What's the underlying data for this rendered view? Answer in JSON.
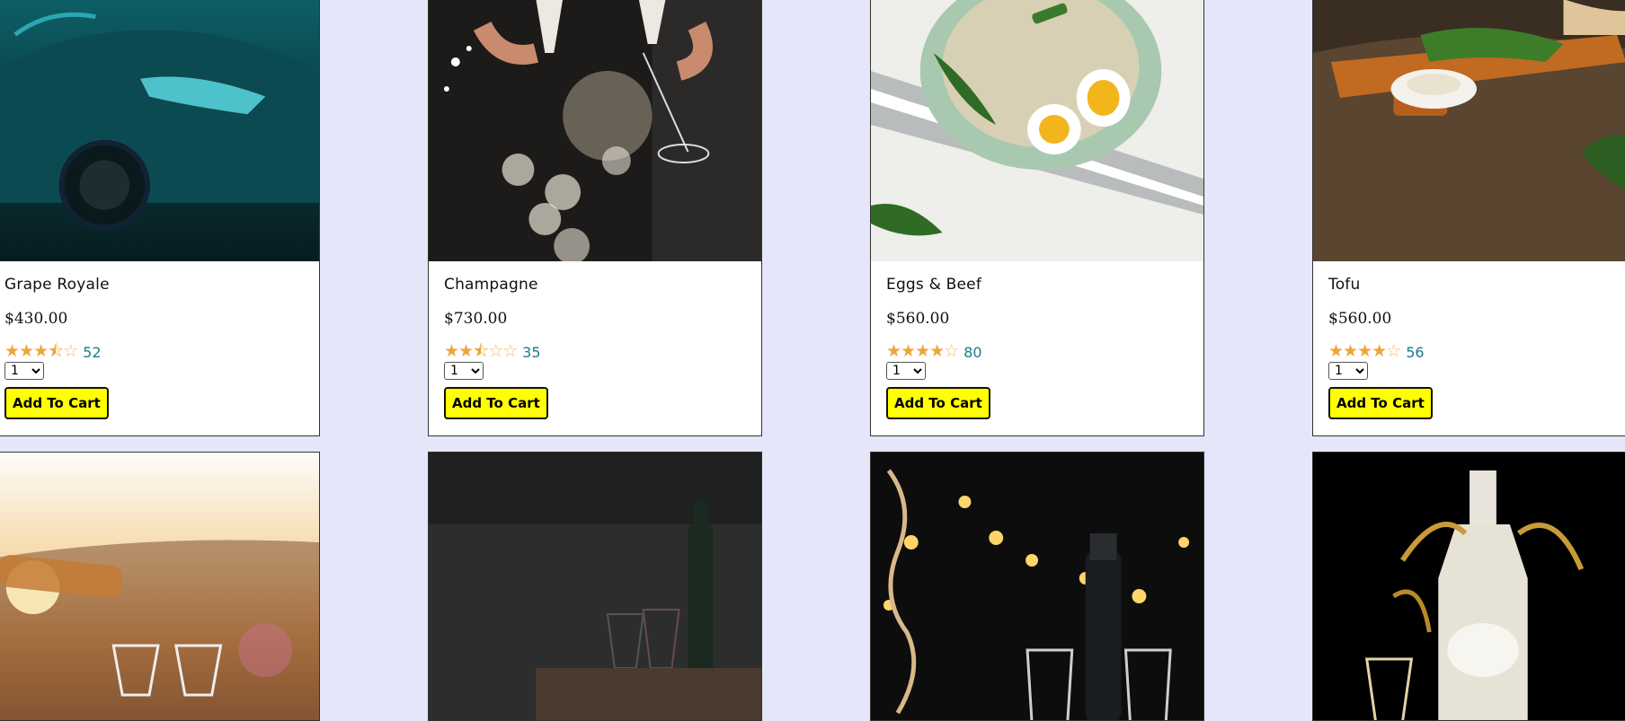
{
  "products": [
    {
      "name": "Grape Royale",
      "price": "$430.00",
      "rating": 3.5,
      "reviews": "52",
      "qty": "1",
      "button": "Add To Cart"
    },
    {
      "name": "Champagne",
      "price": "$730.00",
      "rating": 2.5,
      "reviews": "35",
      "qty": "1",
      "button": "Add To Cart"
    },
    {
      "name": "Eggs & Beef",
      "price": "$560.00",
      "rating": 4,
      "reviews": "80",
      "qty": "1",
      "button": "Add To Cart"
    },
    {
      "name": "Tofu",
      "price": "$560.00",
      "rating": 4,
      "reviews": "56",
      "qty": "1",
      "button": "Add To Cart"
    }
  ],
  "colors": {
    "background": "#e6e6fa",
    "button": "#ffff00",
    "star": "#f0a33a",
    "count": "#1a7a8a"
  },
  "images": [
    "car-photo",
    "champagne-toast-photo",
    "rice-eggs-plate-photo",
    "tofu-board-photo",
    "wine-sunset-photo",
    "dark-bottle-photo",
    "party-lights-bottle-photo",
    "wine-splash-photo"
  ]
}
